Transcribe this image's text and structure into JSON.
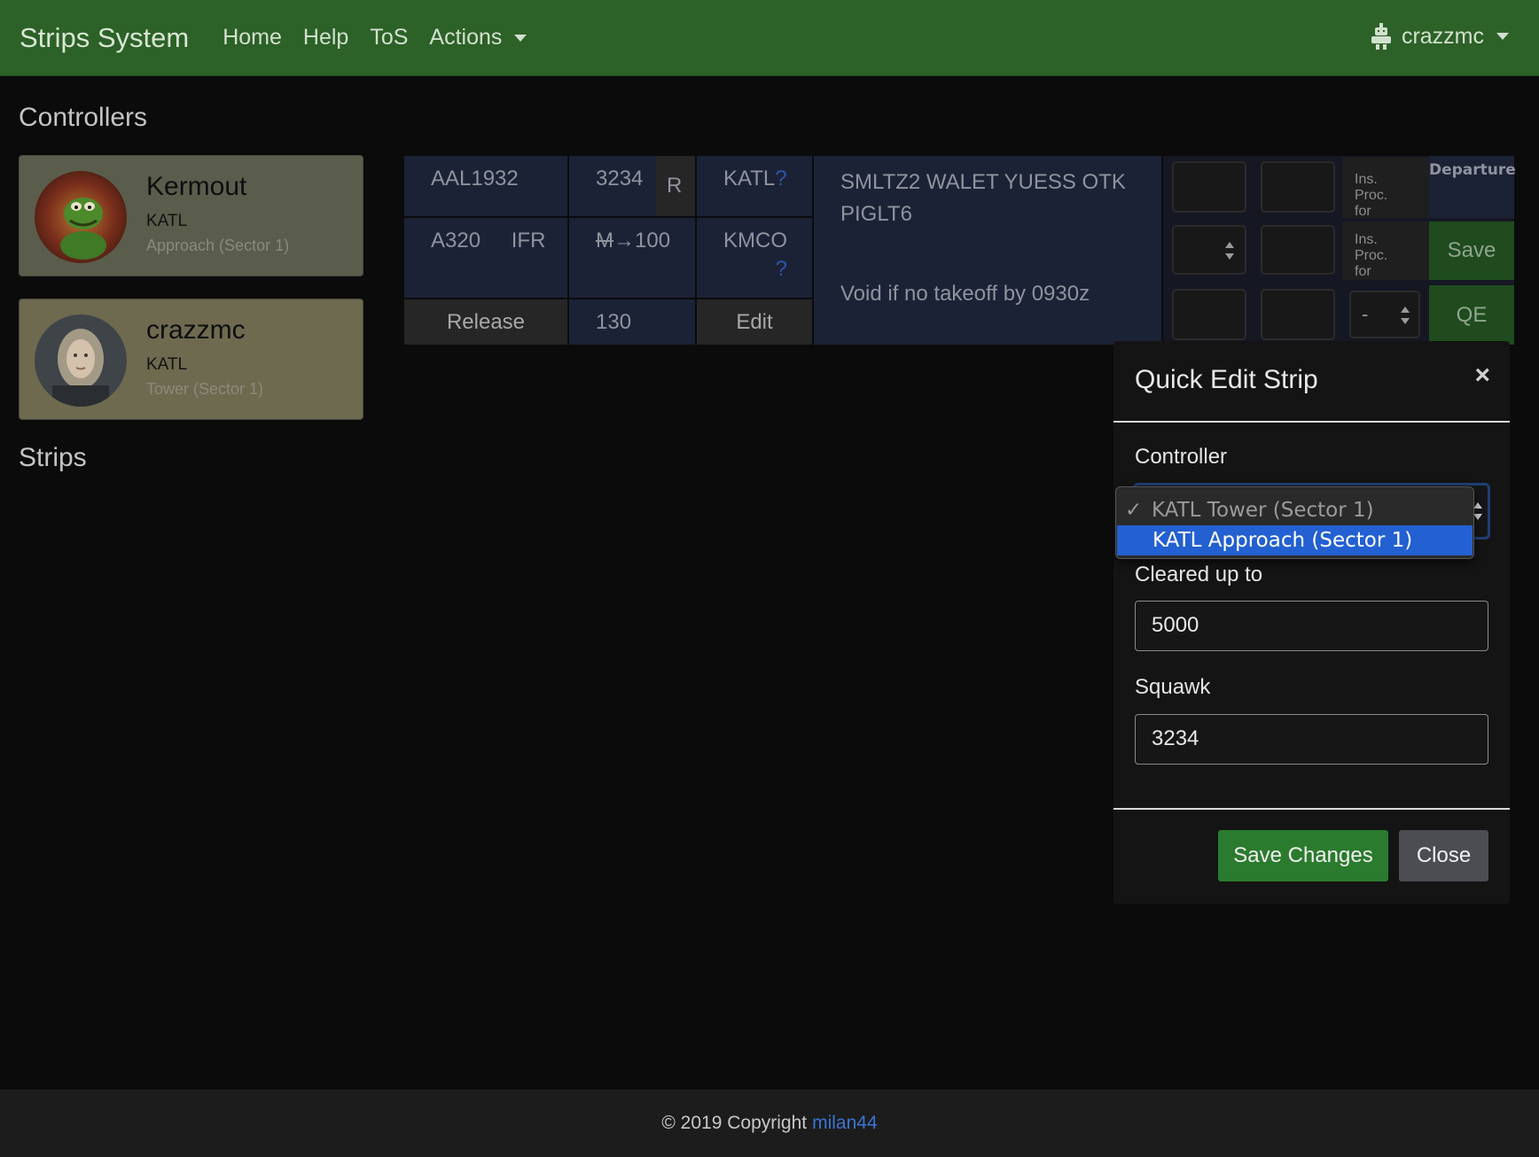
{
  "navbar": {
    "brand": "Strips System",
    "links": [
      "Home",
      "Help",
      "ToS",
      "Actions"
    ],
    "user": "crazzmc",
    "user_icon": "robot-icon"
  },
  "sections": {
    "controllers": "Controllers",
    "strips": "Strips"
  },
  "controllers": [
    {
      "name": "Kermout",
      "airport": "KATL",
      "position": "Approach (Sector 1)"
    },
    {
      "name": "crazzmc",
      "airport": "KATL",
      "position": "Tower (Sector 1)"
    }
  ],
  "strip": {
    "callsign": "AAL1932",
    "squawk": "3234",
    "rules_flag": "R",
    "departure": "KATL",
    "arrival": "KMCO",
    "unknown_mark": "?",
    "aircraft": "A320",
    "flight_rules": "IFR",
    "altitude_struck": "M",
    "altitude": "→100",
    "route_line1": "SMLTZ2 WALET YUESS OTK",
    "route_line2": "PIGLT6",
    "remarks": "Void if no takeoff by 0930z",
    "release_button": "Release",
    "speed": "130",
    "edit_button": "Edit",
    "ins_proc": [
      "Ins.",
      "Proc.",
      "for"
    ],
    "strip_type": "Departure",
    "save_button": "Save",
    "qe_button": "QE",
    "dash_select": "-"
  },
  "modal": {
    "title": "Quick Edit Strip",
    "close_icon": "×",
    "controller_label": "Controller",
    "controller_options": [
      "KATL Tower (Sector 1)",
      "KATL Approach (Sector 1)"
    ],
    "checkmark": "✓",
    "cleared_label": "Cleared up to",
    "cleared_value": "5000",
    "squawk_label": "Squawk",
    "squawk_value": "3234",
    "save_button": "Save Changes",
    "close_button": "Close"
  },
  "footer": {
    "copyright": "© 2019 Copyright",
    "author": "milan44"
  }
}
